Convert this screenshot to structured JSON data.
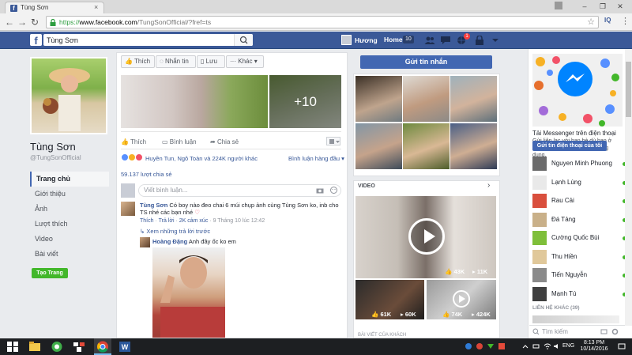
{
  "browser": {
    "tab_title": "Tùng Sơn",
    "url_scheme": "https://",
    "url_host": "www.facebook.com",
    "url_path": "/TungSonOfficial/?fref=ts",
    "ext_label": "IQ"
  },
  "fb_header": {
    "search_value": "Tùng Sơn",
    "user_name": "Hương",
    "home_label": "Home",
    "home_count": "10",
    "notif_count": "1"
  },
  "profile": {
    "name": "Tùng Sơn",
    "handle": "@TungSonOfficial",
    "nav": [
      "Trang chủ",
      "Giới thiệu",
      "Ảnh",
      "Lượt thích",
      "Video",
      "Bài viết"
    ],
    "create_page": "Tạo Trang"
  },
  "page_actions": {
    "like": "Thích",
    "message": "Nhắn tin",
    "save": "Lưu",
    "more": "Khác",
    "send_message": "Gửi tin nhắn"
  },
  "post": {
    "more_photos": "+10",
    "like": "Thích",
    "comment": "Bình luận",
    "share": "Chia sẻ",
    "reactions_text": "Huyền Tun, Ngô Toàn và 224K người khác",
    "sort_label": "Bình luận hàng đầu",
    "shares": "59.137 lượt chia sẻ",
    "comment_placeholder": "Viết bình luận...",
    "comments": [
      {
        "author": "Tùng Sơn",
        "text": "Có boy nào đeo chai 6 múi chụp ảnh cùng Tùng Sơn ko, inb cho TS nhé các bạn nhé",
        "like": "Thích",
        "reply": "Trả lời",
        "reactions": "2K cảm xúc",
        "time": "9 Tháng 10 lúc 12:42"
      }
    ],
    "more_replies": "Xem những trả lời trước",
    "reply": {
      "author": "Hoàng Đặng",
      "text": "Anh đây ốc ko em"
    }
  },
  "videos": {
    "title": "VIDEO",
    "main_stats": [
      "43K",
      "11K"
    ],
    "small": [
      {
        "stats": [
          "61K",
          "60K"
        ]
      },
      {
        "stats": [
          "74K",
          "424K"
        ]
      }
    ],
    "next_section": "BÀI VIẾT CỦA KHÁCH"
  },
  "messenger": {
    "title": "Tải Messenger trên điện thoại",
    "desc": "Gửi liên lạc với bạn bè dù bạn ở đâu. Tải liền kết để cài đặt ứng dụng.",
    "button": "Gửi tin điện thoại của tôi"
  },
  "contacts": [
    {
      "name": "Nguyen Minh Phuong",
      "color": "#6b6b6b"
    },
    {
      "name": "Lạnh Lùng",
      "color": "#e9e9e9"
    },
    {
      "name": "Rau Cải",
      "color": "#d94f3d"
    },
    {
      "name": "Đá Tảng",
      "color": "#c9b089"
    },
    {
      "name": "Cường Quốc Bùi",
      "color": "#7fbf3a"
    },
    {
      "name": "Thu Hiền",
      "color": "#e0c89a"
    },
    {
      "name": "Tiến Nguyễn",
      "color": "#8a8a8a"
    },
    {
      "name": "Mạnh Tú",
      "color": "#3f3f3f"
    }
  ],
  "contacts_more": "LIÊN HỆ KHÁC (39)",
  "chat_search_placeholder": "Tìm kiếm",
  "taskbar": {
    "lang": "ENG",
    "time": "8:13 PM",
    "date": "10/14/2016"
  }
}
